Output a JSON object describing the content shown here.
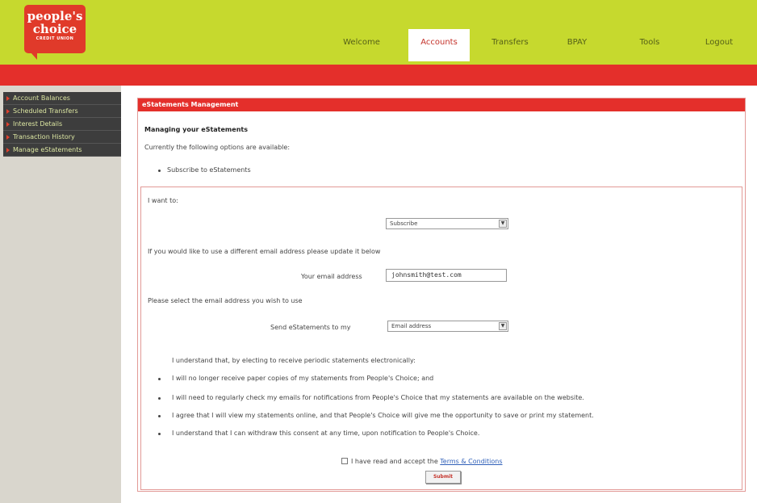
{
  "logo": {
    "line1": "people's",
    "line2": "choice",
    "line3": "CREDIT UNION"
  },
  "nav": [
    {
      "label": "Welcome"
    },
    {
      "label": "Accounts"
    },
    {
      "label": "Transfers"
    },
    {
      "label": "BPAY"
    },
    {
      "label": "Tools"
    },
    {
      "label": "Logout"
    }
  ],
  "colors": {
    "header": "#c6d92e",
    "accent_red": "#e42f2b",
    "sidebar_bg": "#3d3d3d",
    "sidebar_text": "#dce6a2"
  },
  "sidebar": {
    "items": [
      {
        "label": "Account Balances"
      },
      {
        "label": "Scheduled Transfers"
      },
      {
        "label": "Interest Details"
      },
      {
        "label": "Transaction History"
      },
      {
        "label": "Manage eStatements"
      }
    ]
  },
  "main": {
    "panel_title": "eStatements Management",
    "heading": "Managing your eStatements",
    "options_intro": "Currently the following options are available:",
    "option_item": "Subscribe to eStatements",
    "want_label": "I want to:",
    "action_select": "Subscribe",
    "email_intro": "If you would like to use a different email address please update it below",
    "email_label": "Your email address",
    "email_value": "johnsmith@test.com",
    "select_email_intro": "Please select the email address you wish to use",
    "send_label": "Send eStatements to my",
    "send_select": "Email address",
    "terms_intro": "I understand that, by electing to receive periodic statements electronically:",
    "terms": [
      "I will no longer receive paper copies of my statements from People's Choice; and",
      "I will need to regularly check my emails for notifications from People's Choice that my statements are available on the website.",
      "I agree that I will view my statements online, and that People's Choice will give me the opportunity to save or print my statement.",
      "I understand that I can withdraw this consent at any time, upon notification to People's Choice."
    ],
    "accept_text": "I have read and accept the",
    "terms_link": "Terms & Conditions",
    "submit_label": "Submit"
  }
}
